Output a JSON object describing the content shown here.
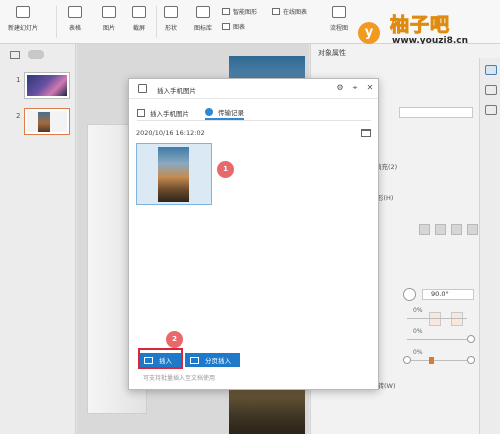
{
  "ribbon": {
    "buttons": [
      {
        "label": "新建幻灯片",
        "icon": "new-slide-icon"
      },
      {
        "label": "表格",
        "icon": "table-icon"
      },
      {
        "label": "图片",
        "icon": "picture-icon"
      },
      {
        "label": "截屏",
        "icon": "screenshot-icon"
      },
      {
        "label": "形状",
        "icon": "shape-icon"
      },
      {
        "label": "图标库",
        "icon": "icon-library-icon"
      },
      {
        "label": "流程图",
        "icon": "flowchart-icon"
      }
    ],
    "small_items": [
      {
        "label": "智能图形",
        "icon": "smart-art-icon"
      },
      {
        "label": "在线图表",
        "icon": "online-chart-icon"
      },
      {
        "label": "图表",
        "icon": "chart-icon"
      }
    ]
  },
  "watermark": {
    "badge": "y",
    "title": "柚子吧",
    "url": "www.youzi8.cn"
  },
  "left_panel": {
    "slides": [
      {
        "number": "1",
        "selected": false
      },
      {
        "number": "2",
        "selected": true
      }
    ]
  },
  "right_pane": {
    "title": "对象属性",
    "labels": [
      "填充(2)",
      "形(H)",
      "90.0°",
      "0%",
      "0%",
      "0%",
      "旋转(W)"
    ]
  },
  "dialog": {
    "title": "插入手机图片",
    "tabs": [
      {
        "label": "插入手机图片",
        "active": false
      },
      {
        "label": "传输记录",
        "active": true
      }
    ],
    "date": "2020/10/16 16:12:02",
    "badge1": "1",
    "badge2": "2",
    "insert_label": "插入",
    "insert_pages_label": "分页插入",
    "hint": "可支持批量插入至文档使用"
  },
  "colors": {
    "accent_blue": "#1f79c9",
    "badge_red": "#e8686b",
    "highlight_red": "#d8263a",
    "selection_orange": "#e07b4a"
  }
}
